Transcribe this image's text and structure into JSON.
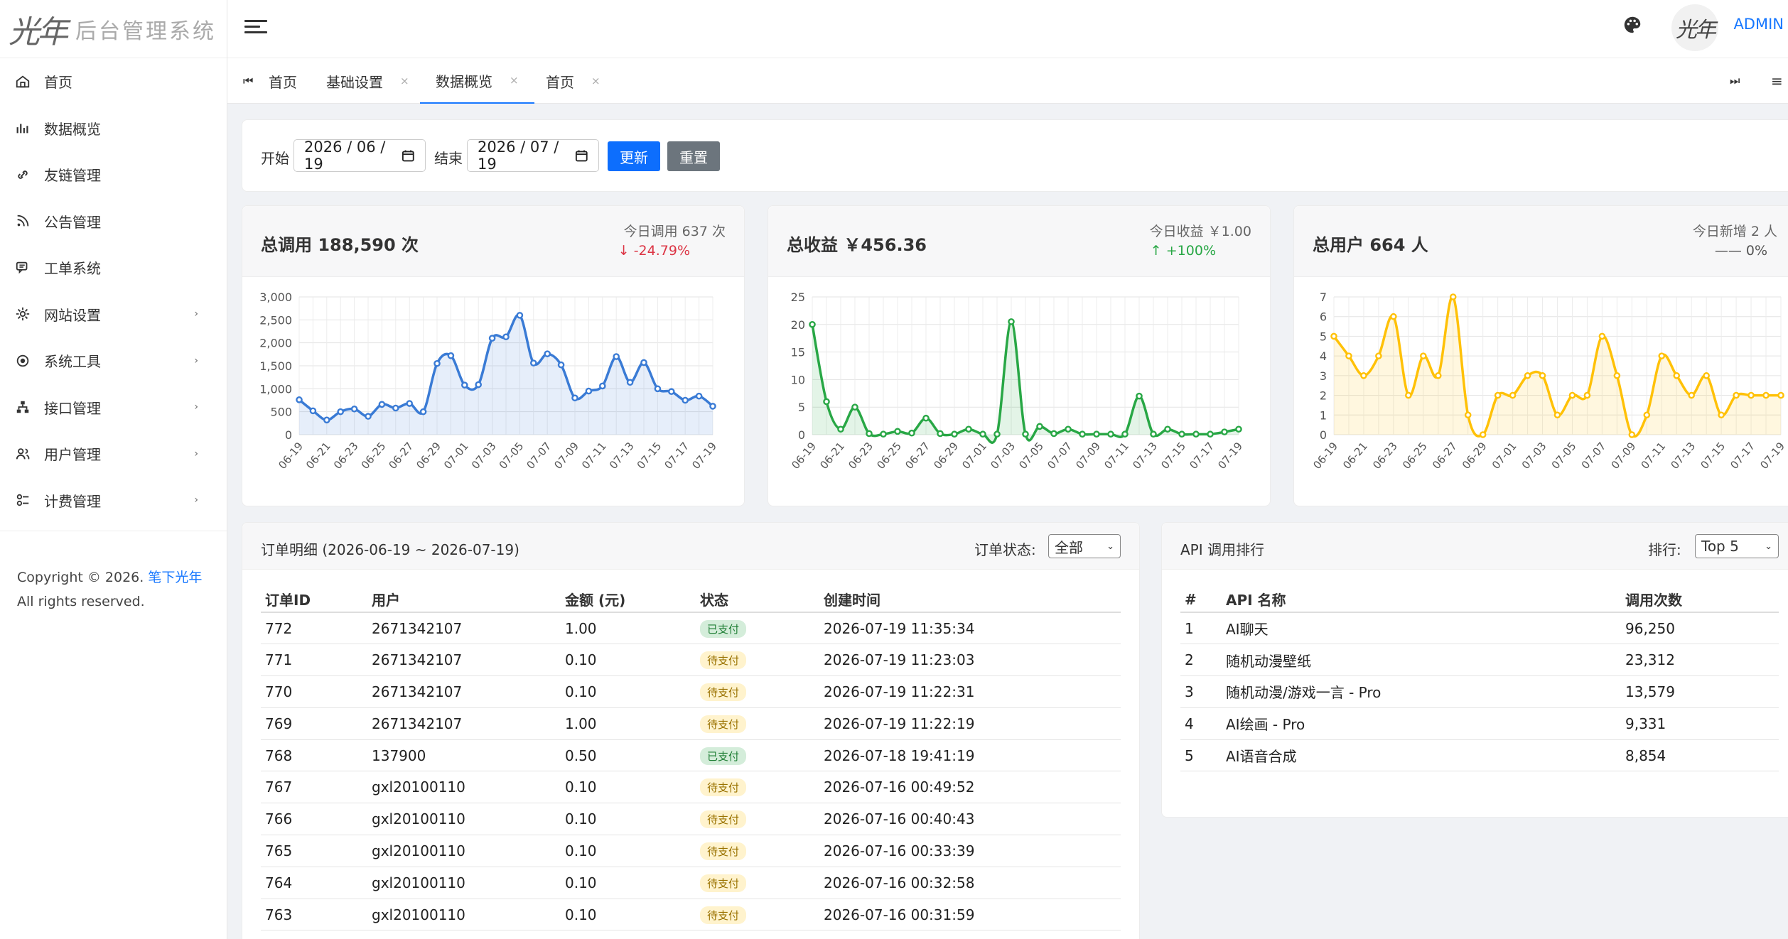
{
  "brand": {
    "mark": "光年",
    "name": "后台管理系统"
  },
  "sidebar": {
    "items": [
      {
        "label": "首页",
        "icon": "home-icon",
        "has_children": false
      },
      {
        "label": "数据概览",
        "icon": "chart-icon",
        "has_children": false
      },
      {
        "label": "友链管理",
        "icon": "link-icon",
        "has_children": false
      },
      {
        "label": "公告管理",
        "icon": "rss-icon",
        "has_children": false
      },
      {
        "label": "工单系统",
        "icon": "chat-icon",
        "has_children": false
      },
      {
        "label": "网站设置",
        "icon": "gear-icon",
        "has_children": true
      },
      {
        "label": "系统工具",
        "icon": "target-icon",
        "has_children": true
      },
      {
        "label": "接口管理",
        "icon": "sitemap-icon",
        "has_children": true
      },
      {
        "label": "用户管理",
        "icon": "users-icon",
        "has_children": true
      },
      {
        "label": "计费管理",
        "icon": "billing-icon",
        "has_children": true
      }
    ],
    "copyright_prefix": "Copyright © 2026.",
    "copyright_link": "笔下光年",
    "copyright_suffix": "All rights reserved."
  },
  "topbar": {
    "username": "ADMIN",
    "avatar_text": "光年"
  },
  "tabs": {
    "items": [
      {
        "label": "首页",
        "closable": false,
        "active": false
      },
      {
        "label": "基础设置",
        "closable": true,
        "active": false
      },
      {
        "label": "数据概览",
        "closable": true,
        "active": true
      },
      {
        "label": "首页",
        "closable": true,
        "active": false
      }
    ],
    "close_glyph": "×"
  },
  "filter": {
    "start_label": "开始",
    "start_value": "2026 / 06 / 19",
    "end_label": "结束",
    "end_value": "2026 / 07 / 19",
    "update_label": "更新",
    "reset_label": "重置"
  },
  "stats": [
    {
      "title": "总调用 188,590 次",
      "sub": "今日调用 637 次",
      "change": "↓ -24.79%",
      "change_color": "#dc3545"
    },
    {
      "title": "总收益 ￥456.36",
      "sub": "今日收益 ￥1.00",
      "change": "↑ +100%",
      "change_color": "#28a745"
    },
    {
      "title": "总用户 664 人",
      "sub": "今日新增 2 人",
      "change": "—— 0%",
      "change_color": "#555555"
    }
  ],
  "chart_data": [
    {
      "type": "area",
      "color": "#3a7bd5",
      "x": [
        "06-19",
        "06-20",
        "06-21",
        "06-22",
        "06-23",
        "06-24",
        "06-25",
        "06-26",
        "06-27",
        "06-28",
        "06-29",
        "06-30",
        "07-01",
        "07-02",
        "07-03",
        "07-04",
        "07-05",
        "07-06",
        "07-07",
        "07-08",
        "07-09",
        "07-10",
        "07-11",
        "07-12",
        "07-13",
        "07-14",
        "07-15",
        "07-16",
        "07-17",
        "07-18",
        "07-19"
      ],
      "tick_labels": [
        "06-19",
        "06-21",
        "06-23",
        "06-25",
        "06-27",
        "06-29",
        "07-01",
        "07-03",
        "07-05",
        "07-07",
        "07-09",
        "07-11",
        "07-13",
        "07-15",
        "07-17",
        "07-19"
      ],
      "values": [
        760,
        520,
        320,
        500,
        560,
        400,
        660,
        580,
        680,
        500,
        1550,
        1720,
        1080,
        1090,
        2100,
        2130,
        2600,
        1560,
        1760,
        1520,
        800,
        950,
        1060,
        1700,
        1140,
        1570,
        1000,
        940,
        750,
        840,
        620
      ],
      "ylim": [
        0,
        3000
      ],
      "yticks": [
        0,
        500,
        1000,
        1500,
        2000,
        2500,
        3000
      ],
      "ytick_labels": [
        "0",
        "500",
        "1,000",
        "1,500",
        "2,000",
        "2,500",
        "3,000"
      ],
      "grid": true
    },
    {
      "type": "area",
      "color": "#28a745",
      "x": [
        "06-19",
        "06-20",
        "06-21",
        "06-22",
        "06-23",
        "06-24",
        "06-25",
        "06-26",
        "06-27",
        "06-28",
        "06-29",
        "06-30",
        "07-01",
        "07-02",
        "07-03",
        "07-04",
        "07-05",
        "07-06",
        "07-07",
        "07-08",
        "07-09",
        "07-10",
        "07-11",
        "07-12",
        "07-13",
        "07-14",
        "07-15",
        "07-16",
        "07-17",
        "07-18",
        "07-19"
      ],
      "tick_labels": [
        "06-19",
        "06-21",
        "06-23",
        "06-25",
        "06-27",
        "06-29",
        "07-01",
        "07-03",
        "07-05",
        "07-07",
        "07-09",
        "07-11",
        "07-13",
        "07-15",
        "07-17",
        "07-19"
      ],
      "values": [
        20,
        6,
        1,
        5,
        0.2,
        0.1,
        0.6,
        0.3,
        3,
        0.2,
        0.1,
        1,
        0.1,
        0.1,
        20.5,
        0.1,
        1.5,
        0.2,
        1,
        0.1,
        0.1,
        0.1,
        0.1,
        7,
        0.1,
        1,
        0.1,
        0.1,
        0.1,
        0.5,
        1
      ],
      "ylim": [
        0,
        25
      ],
      "yticks": [
        0,
        5,
        10,
        15,
        20,
        25
      ],
      "ytick_labels": [
        "0",
        "5",
        "10",
        "15",
        "20",
        "25"
      ],
      "grid": true
    },
    {
      "type": "area",
      "color": "#ffc107",
      "x": [
        "06-19",
        "06-20",
        "06-21",
        "06-22",
        "06-23",
        "06-24",
        "06-25",
        "06-26",
        "06-27",
        "06-28",
        "06-29",
        "06-30",
        "07-01",
        "07-02",
        "07-03",
        "07-04",
        "07-05",
        "07-06",
        "07-07",
        "07-08",
        "07-09",
        "07-10",
        "07-11",
        "07-12",
        "07-13",
        "07-14",
        "07-15",
        "07-16",
        "07-17",
        "07-18",
        "07-19"
      ],
      "tick_labels": [
        "06-19",
        "06-21",
        "06-23",
        "06-25",
        "06-27",
        "06-29",
        "07-01",
        "07-03",
        "07-05",
        "07-07",
        "07-09",
        "07-11",
        "07-13",
        "07-15",
        "07-17",
        "07-19"
      ],
      "values": [
        5,
        4,
        3,
        4,
        6,
        2,
        4,
        3,
        7,
        1,
        0,
        2,
        2,
        3,
        3,
        1,
        2,
        2,
        5,
        3,
        0,
        1,
        4,
        3,
        2,
        3,
        1,
        2,
        2,
        2,
        2
      ],
      "ylim": [
        0,
        7
      ],
      "yticks": [
        0,
        1,
        2,
        3,
        4,
        5,
        6,
        7
      ],
      "ytick_labels": [
        "0",
        "1",
        "2",
        "3",
        "4",
        "5",
        "6",
        "7"
      ],
      "grid": true
    }
  ],
  "orders": {
    "title": "订单明细 (2026-06-19 ~ 2026-07-19)",
    "status_label": "订单状态:",
    "status_value": "全部",
    "headers": [
      "订单ID",
      "用户",
      "金额 (元)",
      "状态",
      "创建时间"
    ],
    "rows": [
      {
        "id": "772",
        "user": "2671342107",
        "amount": "1.00",
        "status": "已支付",
        "paid": true,
        "time": "2026-07-19 11:35:34"
      },
      {
        "id": "771",
        "user": "2671342107",
        "amount": "0.10",
        "status": "待支付",
        "paid": false,
        "time": "2026-07-19 11:23:03"
      },
      {
        "id": "770",
        "user": "2671342107",
        "amount": "0.10",
        "status": "待支付",
        "paid": false,
        "time": "2026-07-19 11:22:31"
      },
      {
        "id": "769",
        "user": "2671342107",
        "amount": "1.00",
        "status": "待支付",
        "paid": false,
        "time": "2026-07-19 11:22:19"
      },
      {
        "id": "768",
        "user": "137900",
        "amount": "0.50",
        "status": "已支付",
        "paid": true,
        "time": "2026-07-18 19:41:19"
      },
      {
        "id": "767",
        "user": "gxl20100110",
        "amount": "0.10",
        "status": "待支付",
        "paid": false,
        "time": "2026-07-16 00:49:52"
      },
      {
        "id": "766",
        "user": "gxl20100110",
        "amount": "0.10",
        "status": "待支付",
        "paid": false,
        "time": "2026-07-16 00:40:43"
      },
      {
        "id": "765",
        "user": "gxl20100110",
        "amount": "0.10",
        "status": "待支付",
        "paid": false,
        "time": "2026-07-16 00:33:39"
      },
      {
        "id": "764",
        "user": "gxl20100110",
        "amount": "0.10",
        "status": "待支付",
        "paid": false,
        "time": "2026-07-16 00:32:58"
      },
      {
        "id": "763",
        "user": "gxl20100110",
        "amount": "0.10",
        "status": "待支付",
        "paid": false,
        "time": "2026-07-16 00:31:59"
      }
    ]
  },
  "api_rank": {
    "title": "API 调用排行",
    "rank_label": "排行:",
    "rank_value": "Top 5",
    "headers": [
      "#",
      "API 名称",
      "调用次数"
    ],
    "rows": [
      {
        "rank": "1",
        "name": "AI聊天",
        "count": "96,250"
      },
      {
        "rank": "2",
        "name": "随机动漫壁纸",
        "count": "23,312"
      },
      {
        "rank": "3",
        "name": "随机动漫/游戏一言 - Pro",
        "count": "13,579"
      },
      {
        "rank": "4",
        "name": "AI绘画 - Pro",
        "count": "9,331"
      },
      {
        "rank": "5",
        "name": "AI语音合成",
        "count": "8,854"
      }
    ]
  }
}
